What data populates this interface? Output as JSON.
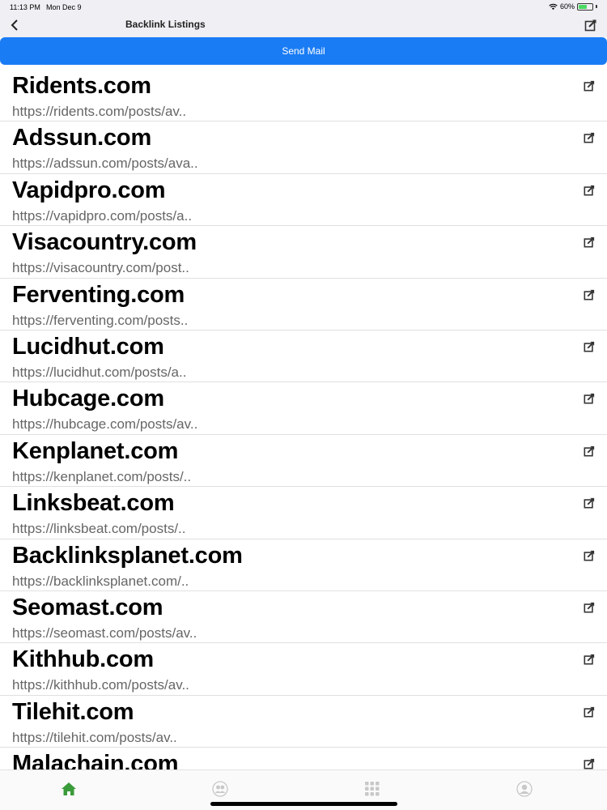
{
  "status_bar": {
    "time": "11:13 PM",
    "date": "Mon Dec 9",
    "battery": "60%",
    "battery_level": 0.6
  },
  "nav": {
    "title": "Backlink Listings",
    "back_icon": "chevron-left-icon",
    "compose_icon": "compose-icon"
  },
  "send_mail": {
    "label": "Send Mail"
  },
  "colors": {
    "accent": "#1a7cf5",
    "active_tab": "#3a9b3a",
    "inactive_tab": "#c8c8c8"
  },
  "listings": [
    {
      "title": "Ridents.com",
      "url": "https://ridents.com/posts/av.."
    },
    {
      "title": "Adssun.com",
      "url": "https://adssun.com/posts/ava.."
    },
    {
      "title": "Vapidpro.com",
      "url": "https://vapidpro.com/posts/a.."
    },
    {
      "title": "Visacountry.com",
      "url": "https://visacountry.com/post.."
    },
    {
      "title": "Ferventing.com",
      "url": "https://ferventing.com/posts.."
    },
    {
      "title": "Lucidhut.com",
      "url": "https://lucidhut.com/posts/a.."
    },
    {
      "title": "Hubcage.com",
      "url": "https://hubcage.com/posts/av.."
    },
    {
      "title": "Kenplanet.com",
      "url": "https://kenplanet.com/posts/.."
    },
    {
      "title": "Linksbeat.com",
      "url": "https://linksbeat.com/posts/.."
    },
    {
      "title": "Backlinksplanet.com",
      "url": "https://backlinksplanet.com/.."
    },
    {
      "title": "Seomast.com",
      "url": "https://seomast.com/posts/av.."
    },
    {
      "title": "Kithhub.com",
      "url": "https://kithhub.com/posts/av.."
    },
    {
      "title": "Tilehit.com",
      "url": "https://tilehit.com/posts/av.."
    },
    {
      "title": "Malachain.com",
      "url": ""
    }
  ],
  "tabs": [
    {
      "icon": "home-icon",
      "active": true
    },
    {
      "icon": "users-icon",
      "active": false
    },
    {
      "icon": "grid-icon",
      "active": false
    },
    {
      "icon": "profile-icon",
      "active": false
    }
  ]
}
